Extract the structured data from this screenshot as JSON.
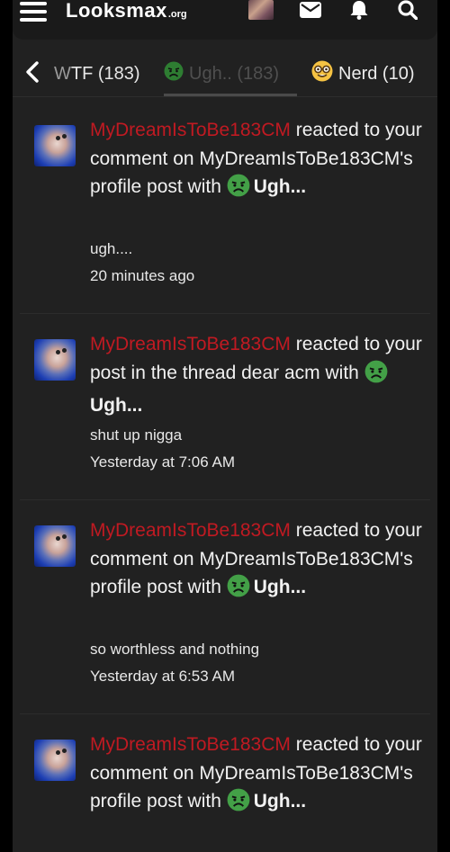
{
  "header": {
    "logo_main": "Looksmax",
    "logo_tld": ".org",
    "icons": [
      "menu-icon",
      "avatar",
      "mail-icon",
      "bell-icon",
      "search-icon"
    ]
  },
  "tabs": [
    {
      "label": "WTF (183)",
      "label_faded_prefix": "W",
      "label_rest": "TF (183)",
      "active": false
    },
    {
      "label": "Ugh.. (183)",
      "emoji": "nauseated-face",
      "active": true
    },
    {
      "label": "Nerd (10)",
      "emoji": "nerd-face",
      "active": false
    }
  ],
  "alerts": [
    {
      "user": "MyDreamIsToBe183CM",
      "text_after_user": " reacted to your comment on MyDreamIsToBe183CM's profile post with ",
      "reaction": "Ugh...",
      "snippet": "ugh....",
      "time": "20 minutes ago"
    },
    {
      "user": "MyDreamIsToBe183CM",
      "text_after_user": " reacted to your post in the thread dear acm with ",
      "reaction": "Ugh...",
      "snippet": "shut up nigga",
      "time": "Yesterday at 7:06 AM"
    },
    {
      "user": "MyDreamIsToBe183CM",
      "text_after_user": " reacted to your comment on MyDreamIsToBe183CM's profile post with ",
      "reaction": "Ugh...",
      "snippet": "so worthless and nothing",
      "time": "Yesterday at 6:53 AM"
    },
    {
      "user": "MyDreamIsToBe183CM",
      "text_after_user": " reacted to your comment on MyDreamIsToBe183CM's profile post with ",
      "reaction": "Ugh...",
      "snippet": "",
      "time": ""
    }
  ],
  "colors": {
    "username": "#c01a22",
    "panel_bg": "#212121",
    "page_bg": "#000000"
  }
}
